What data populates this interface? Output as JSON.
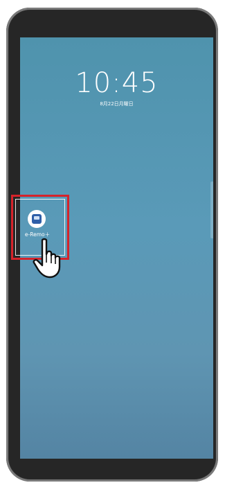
{
  "lockscreen": {
    "time": "10:45",
    "date": "8月22日月曜日"
  },
  "app": {
    "label": "e-Remo＋",
    "icon": "e-remo-app-icon"
  },
  "overlay": {
    "highlight_color": "#d6232a",
    "pointer_icon": "hand-pointer-icon"
  },
  "colors": {
    "wallpaper": "#5a9ab8",
    "phone_frame": "#2b2b2b"
  }
}
